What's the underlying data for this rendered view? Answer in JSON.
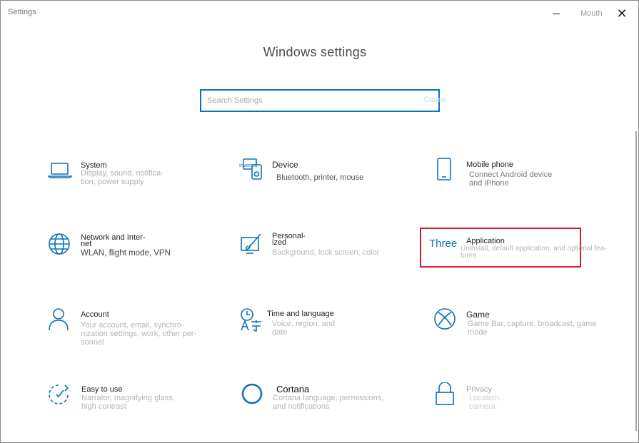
{
  "window": {
    "title": "Settings",
    "maximize_label": "Mouth",
    "close_glyph": "✕"
  },
  "header": {
    "title": "Windows settings"
  },
  "search": {
    "placeholder": "Search Settings",
    "trailing_label": "Cause"
  },
  "tiles": [
    {
      "icon": "laptop-icon",
      "title": "System",
      "desc": "Display, sound, notifica-\ntion, power supply"
    },
    {
      "icon": "device-icon",
      "icon_badge": "Inverted",
      "title": "Device",
      "desc": "Bluetooth, printer, mouse"
    },
    {
      "icon": "phone-icon",
      "title": "Mobile phone",
      "desc": "Connect Android device\nand iPhone"
    },
    {
      "icon": "globe-icon",
      "title": "Network and Inter-\nnet",
      "desc": "WLAN, flight mode, VPN"
    },
    {
      "icon": "paint-icon",
      "title": "Personal-\nized",
      "desc": "Background, lock screen, color"
    },
    {
      "icon": "apps-icon",
      "icon_text": "Three",
      "title": "Application",
      "desc": "Uninstall, default application, and optional fea-\ntures"
    },
    {
      "icon": "person-icon",
      "title": "Account",
      "desc": "Your account, email, synchro-\nnization settings, work, other per-\nsonnel"
    },
    {
      "icon": "time-language-icon",
      "title": "Time and language",
      "desc": "Voice, region, and\ndate"
    },
    {
      "icon": "xbox-icon",
      "title": "Game",
      "desc": "Game Bar, capture, broadcast, game\nmode"
    },
    {
      "icon": "ease-of-access-icon",
      "title": "Easy to use",
      "desc": "Narrator, magnifying glass,\nhigh contrast"
    },
    {
      "icon": "cortana-icon",
      "title": "Cortana",
      "desc": "Cortana language, permissions,\nand notifications"
    },
    {
      "icon": "lock-icon",
      "title": "Privacy",
      "desc": "Location,\ncamera"
    }
  ],
  "colors": {
    "accent": "#0a73b9",
    "highlight": "#d21d2a"
  }
}
